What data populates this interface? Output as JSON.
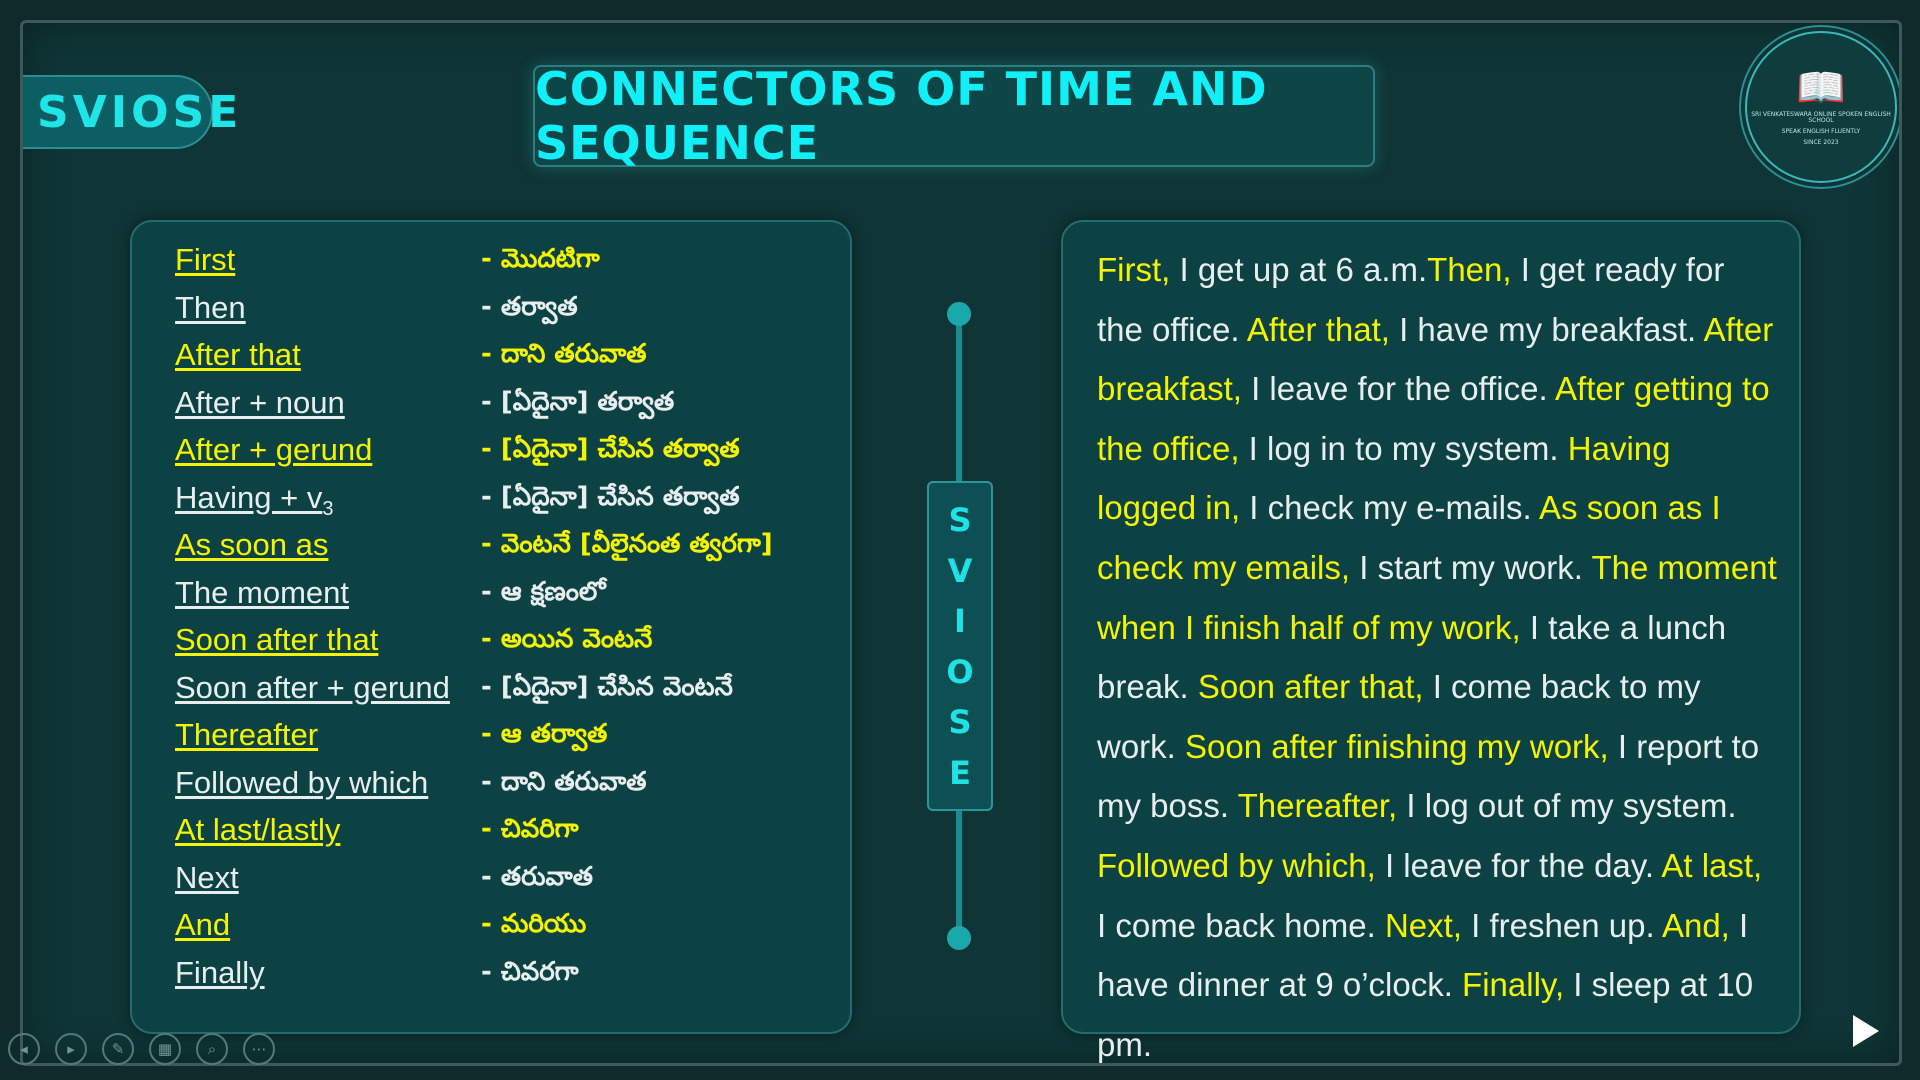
{
  "brand_tag": "SVIOSE",
  "title": "CONNECTORS OF TIME AND SEQUENCE",
  "logo": {
    "text": "SRI VENKATESWARA ONLINE SPOKEN ENGLISH SCHOOL",
    "tagline": "SPEAK ENGLISH FLUENTLY",
    "since": "SINCE 2023"
  },
  "connectors": [
    {
      "english": "First",
      "telugu": "- మొదటిగా",
      "highlight": true
    },
    {
      "english": "Then",
      "telugu": "- తర్వాత",
      "highlight": false
    },
    {
      "english": "After that",
      "telugu": "- దాని తరువాత",
      "highlight": true
    },
    {
      "english": "After + noun",
      "telugu": "- [ఏదైనా] తర్వాత",
      "highlight": false
    },
    {
      "english": "After + gerund",
      "telugu": "- [ఏదైనా] చేసిన తర్వాత",
      "highlight": true
    },
    {
      "english": "Having + v",
      "english_sub": "3",
      "telugu": "- [ఏదైనా] చేసిన తర్వాత",
      "highlight": false
    },
    {
      "english": "As soon as",
      "telugu": "- వెంటనే [వీలైనంత త్వరగా]",
      "highlight": true
    },
    {
      "english": "The moment",
      "telugu": "- ఆ క్షణంలో",
      "highlight": false
    },
    {
      "english": "Soon after that",
      "telugu": "- అయిన వెంటనే",
      "highlight": true
    },
    {
      "english": "Soon after + gerund",
      "telugu": "- [ఏదైనా] చేసిన వెంటనే",
      "highlight": false
    },
    {
      "english": "Thereafter",
      "telugu": "- ఆ తర్వాత",
      "highlight": true
    },
    {
      "english": "Followed by which",
      "telugu": "- దాని తరువాత",
      "highlight": false
    },
    {
      "english": "At last/lastly",
      "telugu": "- చివరిగా",
      "highlight": true
    },
    {
      "english": "Next",
      "telugu": "- తరువాత",
      "highlight": false
    },
    {
      "english": "And",
      "telugu": "- మరియు",
      "highlight": true
    },
    {
      "english": "Finally",
      "telugu": "- చివరగా",
      "highlight": false
    }
  ],
  "vertical_label": [
    "S",
    "V",
    "I",
    "O",
    "S",
    "E"
  ],
  "paragraph": [
    {
      "t": "First,",
      "c": true
    },
    {
      "t": " I get up at 6 a.m.",
      "c": false
    },
    {
      "t": "Then,",
      "c": true
    },
    {
      "t": " I get ready for the office. ",
      "c": false
    },
    {
      "t": "After that,",
      "c": true
    },
    {
      "t": " I have my breakfast. ",
      "c": false
    },
    {
      "t": "After breakfast,",
      "c": true
    },
    {
      "t": " I leave for the office. ",
      "c": false
    },
    {
      "t": "After getting to the office,",
      "c": true
    },
    {
      "t": " I log in to my system. ",
      "c": false
    },
    {
      "t": "Having logged in,",
      "c": true
    },
    {
      "t": " I check my e-mails. ",
      "c": false
    },
    {
      "t": "As soon as I check my emails,",
      "c": true
    },
    {
      "t": " I start my work. ",
      "c": false
    },
    {
      "t": "The moment when I finish half of my work,",
      "c": true
    },
    {
      "t": " I take a lunch break. ",
      "c": false
    },
    {
      "t": "Soon after that,",
      "c": true
    },
    {
      "t": " I come back to my work. ",
      "c": false
    },
    {
      "t": "Soon after finishing my work,",
      "c": true
    },
    {
      "t": " I report to my boss. ",
      "c": false
    },
    {
      "t": "Thereafter,",
      "c": true
    },
    {
      "t": " I log out of my system. ",
      "c": false
    },
    {
      "t": "Followed by which,",
      "c": true
    },
    {
      "t": " I leave for the day. ",
      "c": false
    },
    {
      "t": "At last,",
      "c": true
    },
    {
      "t": " I come back home. ",
      "c": false
    },
    {
      "t": "Next,",
      "c": true
    },
    {
      "t": " I freshen up. ",
      "c": false
    },
    {
      "t": "And,",
      "c": true
    },
    {
      "t": " I have dinner at 9 o’clock. ",
      "c": false
    },
    {
      "t": "Finally,",
      "c": true
    },
    {
      "t": " I sleep at 10 pm.",
      "c": false
    }
  ],
  "controls": [
    {
      "name": "previous-slide-button",
      "icon": "◂"
    },
    {
      "name": "next-slide-button",
      "icon": "▸"
    },
    {
      "name": "pen-tool-button",
      "icon": "✎"
    },
    {
      "name": "slides-overview-button",
      "icon": "▦"
    },
    {
      "name": "zoom-button",
      "icon": "⌕"
    },
    {
      "name": "more-options-button",
      "icon": "⋯"
    }
  ],
  "colors": {
    "accent_cyan": "#10f0f6",
    "highlight_yellow": "#f4f400",
    "text_white": "#e8eeee",
    "panel_bg": "#0d4244"
  }
}
